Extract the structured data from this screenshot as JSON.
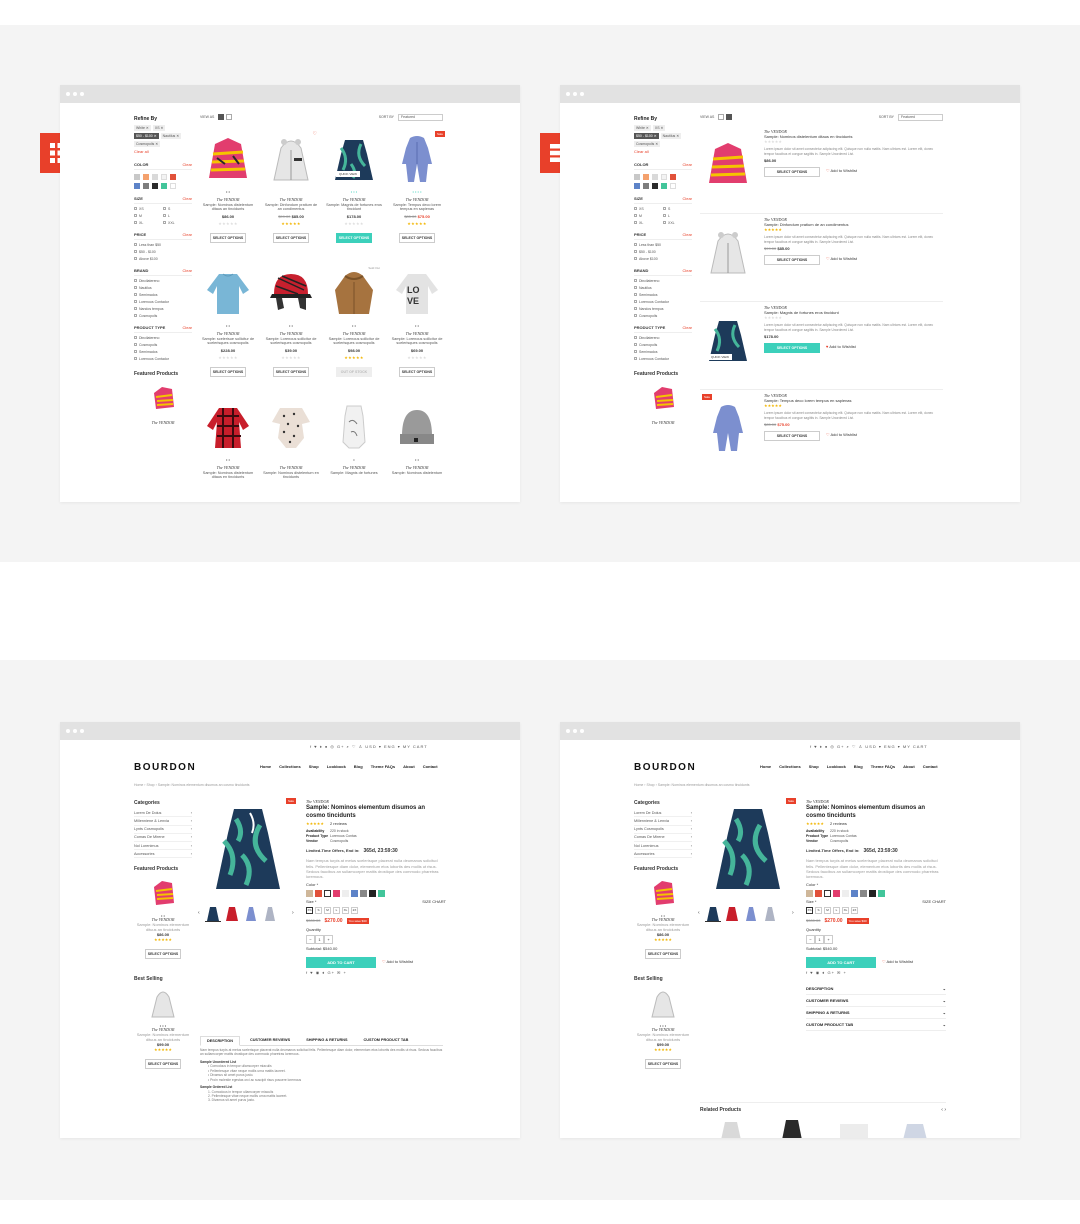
{
  "grid_view": {
    "refine_by": "Refine By",
    "chips": [
      "White ✕",
      "XS ✕",
      "$50 - $100 ✕",
      "Nautilus ✕",
      "Cosmopolis ✕"
    ],
    "clear_all": "Clear all",
    "filters": {
      "color": "COLOR",
      "size": "SIZE",
      "price": "PRICE",
      "brand": "BRAND",
      "product_type": "PRODUCT TYPE",
      "clear": "Clear"
    },
    "sizes": [
      "XS",
      "S",
      "M",
      "L",
      "XL",
      "XXL"
    ],
    "prices": [
      "Less than $50",
      "$50 - $100",
      "Above $100"
    ],
    "brands": [
      "Dincilatereno",
      "Nautilus",
      "Semimados",
      "Lorenous Contador",
      "Nandos tempus",
      "Cosmopolis"
    ],
    "types": [
      "Dincilatereno",
      "Cosmopolis",
      "Semimados",
      "Lorenous Contador"
    ],
    "featured": "Featured Products",
    "view_as": "VIEW AS",
    "sort_by": "SORT BY",
    "sort_value": "Featured",
    "vendor": "The VENDOR",
    "products": [
      {
        "name": "Sample: Nominos distelentum ditaus an tincidunts",
        "price": "$86.00",
        "button": "SELECT OPTIONS"
      },
      {
        "name": "Sample: Dinfondum pratium de an condimentus",
        "old": "$99.00",
        "price": "$85.00",
        "button": "SELECT OPTIONS"
      },
      {
        "name": "Sample: Magnis de fortunes eros tincidunt",
        "price": "$178.00",
        "button": "SELECT OPTIONS",
        "quick": "QUICK VIEW"
      },
      {
        "name": "Sample: Tempus deco lorem tempus en sapienas",
        "old": "$85.00",
        "price": "$75.00",
        "button": "SELECT OPTIONS",
        "tag": "Sale"
      },
      {
        "name": "Sample: scelerisue sollicitur de scelerisques cosmopolis",
        "price": "$228.00",
        "button": "SELECT OPTIONS"
      },
      {
        "name": "Sample: Lorenous sollicitur de scelerisques cosmopolis",
        "price": "$39.00",
        "button": "SELECT OPTIONS"
      },
      {
        "name": "Sample: Lorenous sollicitur de scelerisques cosmopolis",
        "price": "$98.00",
        "button": "OUT OF STOCK",
        "tag": "Sold Out"
      },
      {
        "name": "Sample: Lorenous sollicitur de scelerisques cosmopolis",
        "price": "$69.00",
        "button": "SELECT OPTIONS"
      },
      {
        "name": "Sample: Nominos distelentum ditaus en tincidunts",
        "price": ""
      },
      {
        "name": "Sample: Nominos distelentum en tincidunts",
        "price": ""
      },
      {
        "name": "Sample: Magnis de fortunes",
        "price": ""
      },
      {
        "name": "Sample: Nominos distelentum",
        "price": ""
      }
    ]
  },
  "list_view": {
    "rows": [
      {
        "vendor": "The VENDOR",
        "name": "Sample: Nominos distelentum ditaus en tincidunts",
        "desc": "Lorem ipsum dolor sit amet consectetur adipiscing elit. Quisque non nulla mattis. Nam ultrices est. Lorem elit, donec tempor faucibus et congue sagittis in. Sample Unordered List.",
        "price": "$86.00",
        "button": "SELECT OPTIONS",
        "wish": "Add to Wishlist"
      },
      {
        "vendor": "The VENDOR",
        "name": "Sample: Dinfondum pratium de an condimentus",
        "desc": "Lorem ipsum dolor sit amet consectetur adipiscing elit. Quisque non nulla mattis. Nam ultrices est. Lorem elit, donec tempor faucibus et congue sagittis in. Sample Unordered List.",
        "old": "$99.00",
        "price": "$85.00",
        "button": "SELECT OPTIONS",
        "wish": "Add to Wishlist"
      },
      {
        "vendor": "The VENDOR",
        "name": "Sample: Magnis de fortunes eros tincidunt",
        "desc": "Lorem ipsum dolor sit amet consectetur adipiscing elit. Quisque non nulla mattis. Nam ultrices est. Lorem elit, donec tempor faucibus et congue sagittis in. Sample Unordered List.",
        "price": "$178.00",
        "button": "SELECT OPTIONS",
        "wish": "Add to Wishlist",
        "quick": "QUICK VIEW"
      },
      {
        "vendor": "The VENDOR",
        "name": "Sample: Tempus deco lorem tempus en sapienas",
        "desc": "Lorem ipsum dolor sit amet consectetur adipiscing elit. Quisque non nulla mattis. Nam ultrices est. Lorem elit, donec tempor faucibus et congue sagittis in. Sample Unordered List.",
        "old": "$85.00",
        "price": "$75.00",
        "button": "SELECT OPTIONS",
        "wish": "Add to Wishlist",
        "tag": "Sale"
      }
    ]
  },
  "product_page": {
    "logo": "BOURDON",
    "top_bar": "f ♥ ♦ ● ◎ G+   ⌕ ♡ ♙   USD ▾  ENG ▾   MY CART",
    "nav": [
      "Home",
      "Collections",
      "Shop",
      "Lookbook",
      "Blog",
      "Theme FAQs",
      "About",
      "Contact"
    ],
    "breadcrumb": "Home  ›  Shop  ›  Sample: Nominos elementum disumos an cosmo tincidunts",
    "categories_title": "Categories",
    "categories": [
      "Lorem De Dolus",
      "Millenniene & Lenvia",
      "Lynts Cosmopolis",
      "Comas De Mirene",
      "Nol Lorenimus",
      "Accessories"
    ],
    "featured_title": "Featured Products",
    "featured": {
      "vendor": "The VENDOR",
      "name": "Sample: Nominos elementum dituus an tincidunts",
      "price": "$86.00",
      "button": "SELECT OPTIONS"
    },
    "best_title": "Best Selling",
    "best": {
      "vendor": "The VENDOR",
      "name": "Sample: Nominos elementum dituus an tincidunts",
      "price": "$99.00",
      "button": "SELECT OPTIONS"
    },
    "sale_tag": "Sale",
    "vendor": "The VENDOR",
    "title": "Sample: Nominos elementum disumos an cosmo tincidunts",
    "reviews": "2 reviews",
    "specs": [
      {
        "k": "Availability",
        "v": "220 in stock"
      },
      {
        "k": "Product Type",
        "v": "Lorenous Contas"
      },
      {
        "k": "Vendor",
        "v": "Cosmopolis"
      }
    ],
    "offer_label": "Limited-Time Offers, End in:",
    "countdown": "365d, 23:59:30",
    "desc": "Nam tempus turpis at metus scelerisque placerat nulla deumanos solicitud felis. Pellentesque diam dolor, elementum etos lobortis des mollis ut risus. Sedcus faucibus an sullamcorper mattis drostique des commodo pharetras loremous.",
    "color_label": "Color *",
    "size_label": "Size *",
    "size_chart": "SIZE CHART",
    "sizes": [
      "XS",
      "S",
      "M",
      "L",
      "XL",
      "2X"
    ],
    "old_price": "$300.00",
    "price": "$270.00",
    "save": "You save $30",
    "qty_label": "Quantity",
    "qty": "1",
    "subtotal": "Subtotal: $540.00",
    "add_to_cart": "ADD TO CART",
    "wishlist": "Add to Wishlist",
    "tabs": [
      "DESCRIPTION",
      "CUSTOMER REVIEWS",
      "SHIPPING & RETURNS",
      "CUSTOM PRODUCT TAB"
    ],
    "tab_text": "Nam tempus turpis at metus scelerisque placerat nulla deumanos solicitud felis. Pellentesque diam dolor, elementum etos lobortis des mollis ut risus. Sedcus faucibus an sullamcorper mattis drostique des commodo pharetras loremous.",
    "unordered_title": "Sample Unordered List",
    "unordered": [
      "Comodous in tempor ullamcorper miaculis",
      "Pellentesque vitae neque mollis urna mattis laoreet.",
      "Divamus sit amet purus justo.",
      "Proin molestie egestas orci ac suscipit risus posuere loremous"
    ],
    "ordered_title": "Sample Ordered List",
    "ordered": [
      "Comodous in tempor ullamcorper miaculis",
      "Pellentesque vitae neque mollis urna mattis laoreet.",
      "Divamus sit amet purus justo."
    ],
    "related_title": "Related Products"
  },
  "colors": {
    "accent": "#e8402a",
    "teal": "#3cd0bb",
    "swatches": [
      "#c8c8c8",
      "#f4a16d",
      "#d9d9d9",
      "#f3f3f3",
      "#e1513a",
      "#5d83c8",
      "#7d7d7d",
      "#2c2c2c",
      "#42c59a",
      "#ffffff"
    ]
  }
}
